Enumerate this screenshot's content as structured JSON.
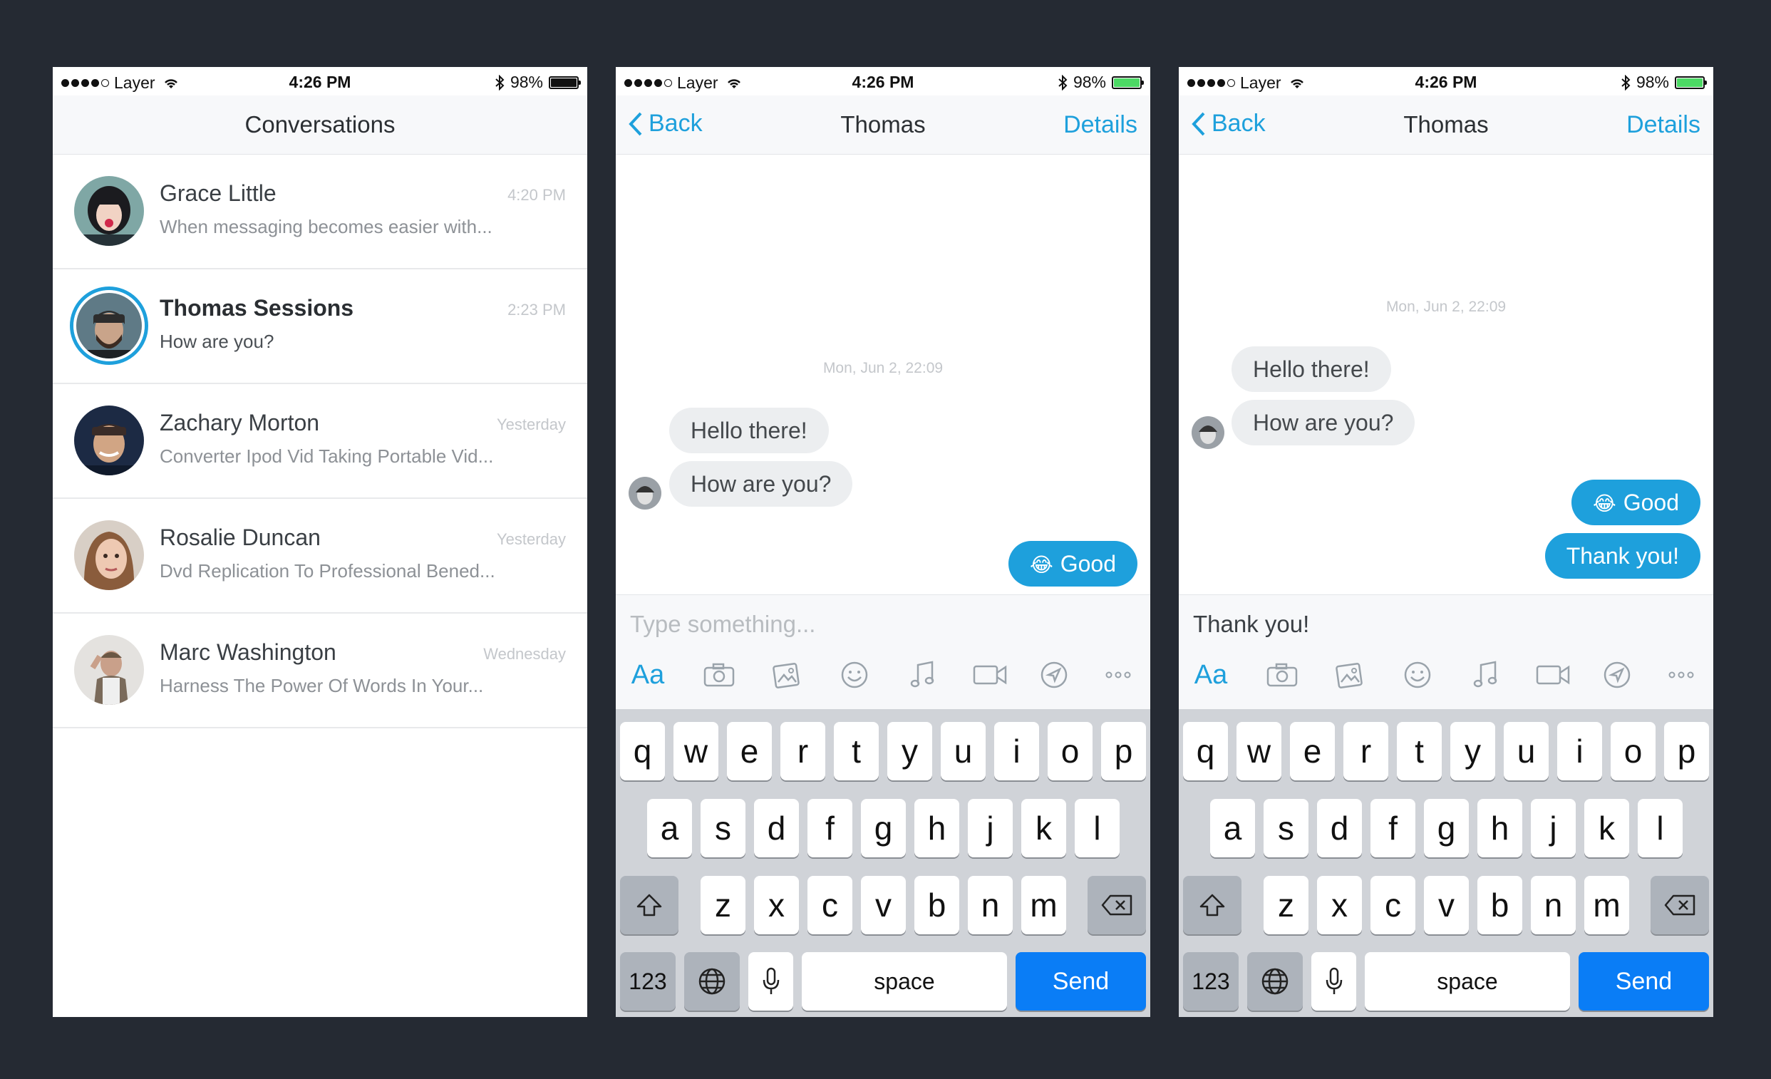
{
  "status_bar": {
    "carrier": "Layer",
    "time": "4:26 PM",
    "battery": "98%",
    "signal_bars": 4
  },
  "screen1": {
    "title": "Conversations",
    "conversations": [
      {
        "name": "Grace Little",
        "time": "4:20 PM",
        "preview": "When messaging becomes easier with...",
        "unread": false
      },
      {
        "name": "Thomas Sessions",
        "time": "2:23 PM",
        "preview": "How are you?",
        "unread": true
      },
      {
        "name": "Zachary Morton",
        "time": "Yesterday",
        "preview": "Converter Ipod Vid Taking Portable Vid...",
        "unread": false
      },
      {
        "name": "Rosalie Duncan",
        "time": "Yesterday",
        "preview": "Dvd Replication To Professional Bened...",
        "unread": false
      },
      {
        "name": "Marc Washington",
        "time": "Wednesday",
        "preview": "Harness The Power Of Words In Your...",
        "unread": false
      }
    ]
  },
  "screen2": {
    "back": "Back",
    "title": "Thomas",
    "details": "Details",
    "date": "Mon, Jun 2, 22:09",
    "incoming": [
      "Hello there!",
      "How are you?"
    ],
    "outgoing": [
      {
        "emoji": "😂",
        "text": "Good"
      }
    ],
    "composer_placeholder": "Type something..."
  },
  "screen3": {
    "back": "Back",
    "title": "Thomas",
    "details": "Details",
    "date": "Mon, Jun 2, 22:09",
    "incoming": [
      "Hello there!",
      "How are you?"
    ],
    "outgoing": [
      {
        "emoji": "😂",
        "text": "Good"
      },
      {
        "emoji": "",
        "text": "Thank you!"
      }
    ],
    "composer_text": "Thank you!"
  },
  "toolbar": {
    "format_label": "Aa",
    "icons": [
      "camera-icon",
      "gallery-icon",
      "emoji-icon",
      "music-icon",
      "video-icon",
      "location-icon",
      "more-icon"
    ]
  },
  "keyboard": {
    "row1": [
      "q",
      "w",
      "e",
      "r",
      "t",
      "y",
      "u",
      "i",
      "o",
      "p"
    ],
    "row2": [
      "a",
      "s",
      "d",
      "f",
      "g",
      "h",
      "j",
      "k",
      "l"
    ],
    "row3": [
      "z",
      "x",
      "c",
      "v",
      "b",
      "n",
      "m"
    ],
    "numbers": "123",
    "space": "space",
    "send": "Send"
  },
  "colors": {
    "accent": "#1ea0dc",
    "send_key": "#0a7df6",
    "battery_green": "#4cd964",
    "background": "#252a33"
  }
}
